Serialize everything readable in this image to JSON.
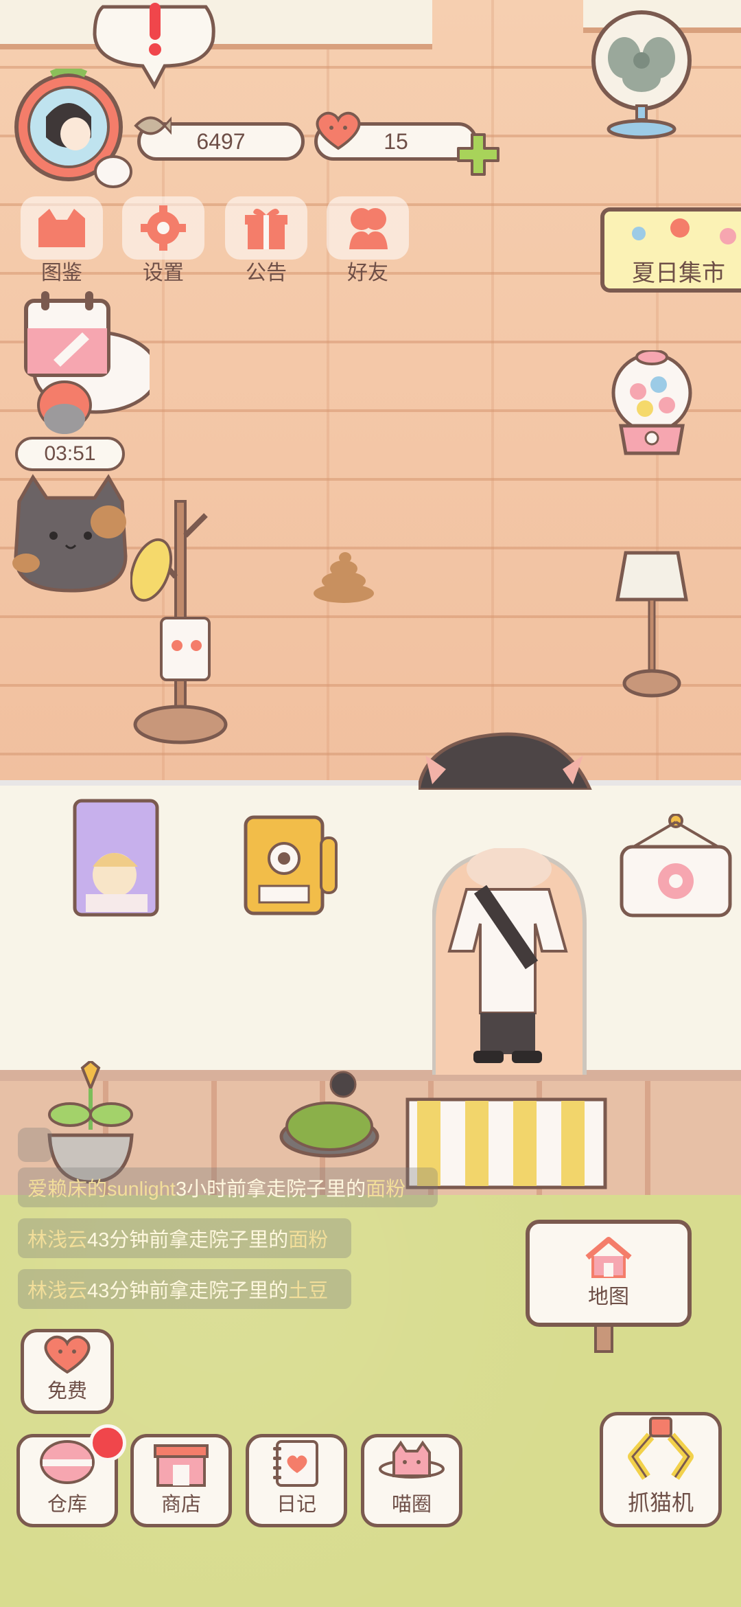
{
  "hud": {
    "fish_count": "6497",
    "heart_count": "15"
  },
  "menu": [
    {
      "label": "图鉴",
      "icon": "cat-head-icon"
    },
    {
      "label": "设置",
      "icon": "gear-icon"
    },
    {
      "label": "公告",
      "icon": "gift-icon"
    },
    {
      "label": "好友",
      "icon": "friends-icon"
    }
  ],
  "event": {
    "label": "夏日集市"
  },
  "timer": {
    "value": "03:51"
  },
  "feed": [
    {
      "name": "爱赖床的sunlight",
      "time": "3小时前拿走院子里的",
      "item": "面粉"
    },
    {
      "name": "林浅云",
      "time": "43分钟前拿走院子里的",
      "item": "面粉"
    },
    {
      "name": "林浅云",
      "time": "43分钟前拿走院子里的",
      "item": "土豆"
    }
  ],
  "map_sign": {
    "label": "地图"
  },
  "free_button": {
    "label": "免费"
  },
  "toolbar": [
    {
      "label": "仓库",
      "icon": "bowl-icon",
      "badge": true
    },
    {
      "label": "商店",
      "icon": "shop-icon",
      "badge": false
    },
    {
      "label": "日记",
      "icon": "diary-icon",
      "badge": false
    },
    {
      "label": "喵圈",
      "icon": "cat-planet-icon",
      "badge": false
    }
  ],
  "claw_machine": {
    "label": "抓猫机"
  },
  "colors": {
    "outline": "#7b5a4f",
    "accent": "#f47d6a",
    "badge": "#f0464b",
    "plus": "#a8d35a",
    "lawn": "#d8dc8f",
    "floor": "#f3c3a2"
  }
}
